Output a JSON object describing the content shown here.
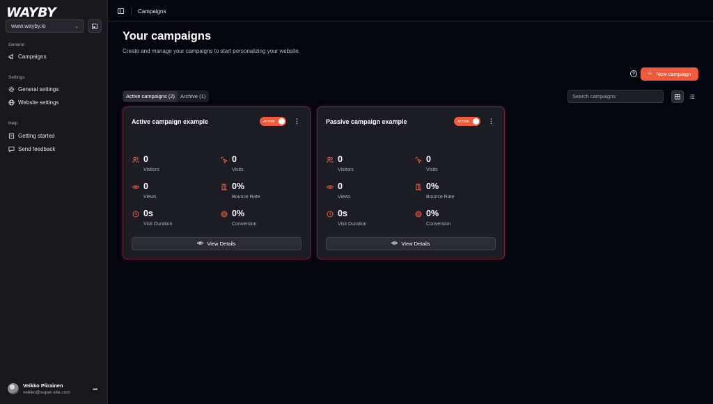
{
  "brand": {
    "logo": "WAYBY"
  },
  "sidebar": {
    "site": {
      "value": "www.wayby.io"
    },
    "sections": [
      {
        "label": "General",
        "items": [
          {
            "label": "Campaigns",
            "icon": "megaphone-icon"
          }
        ]
      },
      {
        "label": "Settings",
        "items": [
          {
            "label": "General settings",
            "icon": "gear-icon"
          },
          {
            "label": "Website settings",
            "icon": "globe-icon"
          }
        ]
      },
      {
        "label": "Help",
        "items": [
          {
            "label": "Getting started",
            "icon": "book-icon"
          },
          {
            "label": "Send feedback",
            "icon": "message-icon"
          }
        ]
      }
    ],
    "user": {
      "name": "Veikko Piirainen",
      "email": "veikko@super-site.com"
    }
  },
  "topbar": {
    "title": "Campaigns"
  },
  "page": {
    "title": "Your campaigns",
    "subtitle": "Create and manage your campaigns to start personalizing your website.",
    "new_button": "New campaign",
    "tabs": [
      {
        "label": "Active campaigns (2)",
        "active": true
      },
      {
        "label": "Archive (1)",
        "active": false
      }
    ],
    "search_placeholder": "Search campaigns"
  },
  "campaigns": [
    {
      "name": "Active campaign example",
      "status": "ACTIVE",
      "metrics": {
        "visitors": {
          "value": "0",
          "label": "Visitors"
        },
        "visits": {
          "value": "0",
          "label": "Visits"
        },
        "views": {
          "value": "0",
          "label": "Views"
        },
        "bounce": {
          "value": "0%",
          "label": "Bounce Rate"
        },
        "duration": {
          "value": "0s",
          "label": "Visit Duration"
        },
        "conversion": {
          "value": "0%",
          "label": "Conversion"
        }
      },
      "details_button": "View Details"
    },
    {
      "name": "Passive campaign example",
      "status": "ACTIVE",
      "metrics": {
        "visitors": {
          "value": "0",
          "label": "Visitors"
        },
        "visits": {
          "value": "0",
          "label": "Visits"
        },
        "views": {
          "value": "0",
          "label": "Views"
        },
        "bounce": {
          "value": "0%",
          "label": "Bounce Rate"
        },
        "duration": {
          "value": "0s",
          "label": "Visit Duration"
        },
        "conversion": {
          "value": "0%",
          "label": "Conversion"
        }
      },
      "details_button": "View Details"
    }
  ],
  "colors": {
    "accent": "#f05a3c",
    "background": "#050510",
    "sidebar": "#17171c",
    "card": "#1c1c24",
    "card_border": "#6b2a30"
  }
}
